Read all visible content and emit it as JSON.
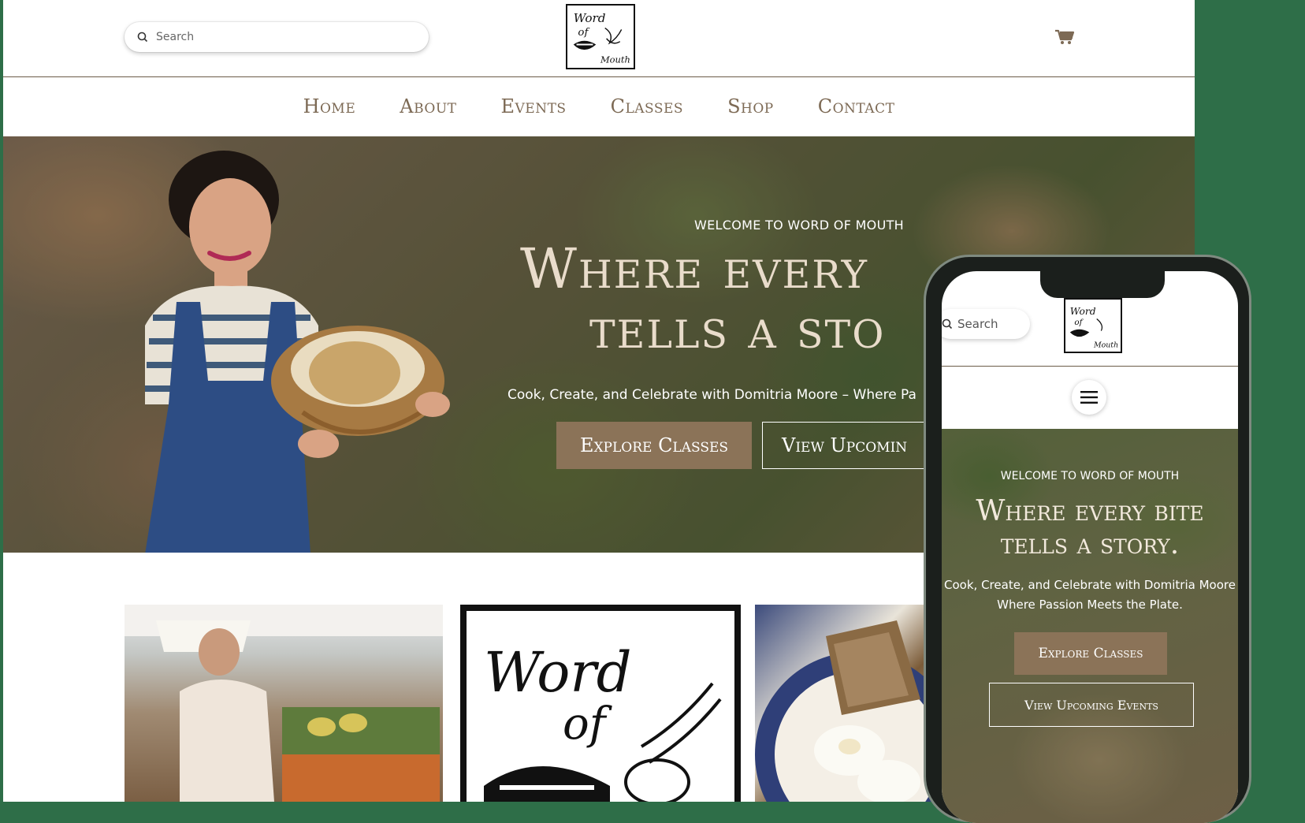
{
  "header": {
    "search_placeholder": "Search",
    "logo_text": [
      "Word",
      "of",
      "Mouth"
    ]
  },
  "nav": {
    "items": [
      {
        "label": "Home"
      },
      {
        "label": "About"
      },
      {
        "label": "Events"
      },
      {
        "label": "Classes"
      },
      {
        "label": "Shop"
      },
      {
        "label": "Contact"
      }
    ]
  },
  "hero": {
    "eyebrow": "WELCOME TO WORD OF MOUTH",
    "title_line1": "Where every",
    "title_line2": "tells a sto",
    "subtitle": "Cook, Create, and Celebrate with Domitria Moore – Where Pa",
    "explore_label": "Explore Classes",
    "view_label": "View Upcomin"
  },
  "mobile": {
    "search_placeholder": "Search",
    "eyebrow": "WELCOME TO WORD OF MOUTH",
    "title_line1": "Where every bite",
    "title_line2": "tells a story.",
    "subtitle_line1": "Cook, Create, and Celebrate with Domitria Moore",
    "subtitle_line2": "Where Passion Meets the Plate.",
    "explore_label": "Explore Classes",
    "view_label": "View Upcoming Events"
  },
  "colors": {
    "background_green": "#2e6e48",
    "accent_brown": "#8b7358",
    "nav_text": "#7d6a55"
  }
}
